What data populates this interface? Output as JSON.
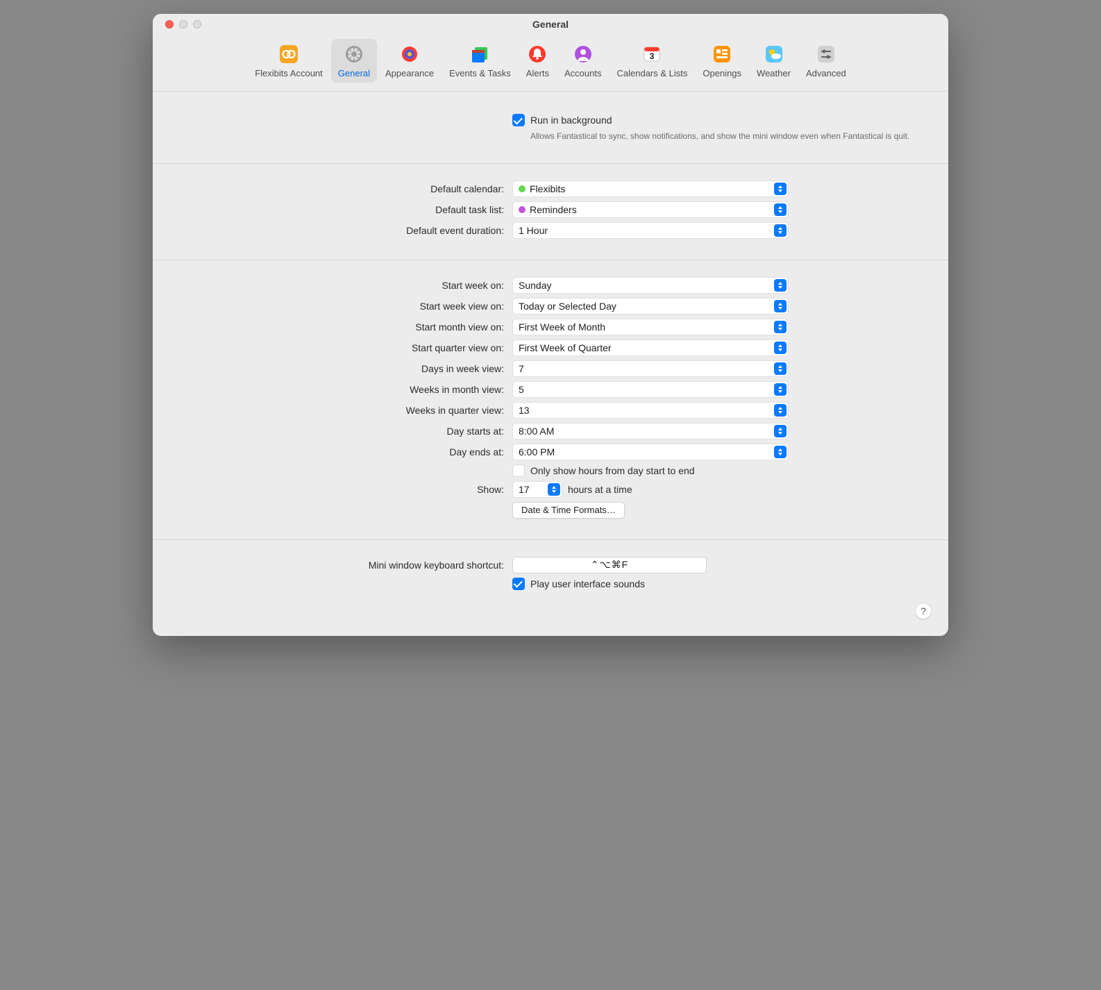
{
  "window": {
    "title": "General"
  },
  "tabs": [
    {
      "label": "Flexibits Account"
    },
    {
      "label": "General"
    },
    {
      "label": "Appearance"
    },
    {
      "label": "Events & Tasks"
    },
    {
      "label": "Alerts"
    },
    {
      "label": "Accounts"
    },
    {
      "label": "Calendars & Lists"
    },
    {
      "label": "Openings"
    },
    {
      "label": "Weather"
    },
    {
      "label": "Advanced"
    }
  ],
  "background": {
    "label": "Run in background",
    "sub": "Allows Fantastical to sync, show notifications, and show the mini window even when Fantastical is quit."
  },
  "defaults": {
    "calendar_label": "Default calendar:",
    "calendar_value": "Flexibits",
    "tasklist_label": "Default task list:",
    "tasklist_value": "Reminders",
    "duration_label": "Default event duration:",
    "duration_value": "1 Hour"
  },
  "views": {
    "start_week_label": "Start week on:",
    "start_week_value": "Sunday",
    "start_weekview_label": "Start week view on:",
    "start_weekview_value": "Today or Selected Day",
    "start_month_label": "Start month view on:",
    "start_month_value": "First Week of Month",
    "start_quarter_label": "Start quarter view on:",
    "start_quarter_value": "First Week of Quarter",
    "days_week_label": "Days in week view:",
    "days_week_value": "7",
    "weeks_month_label": "Weeks in month view:",
    "weeks_month_value": "5",
    "weeks_quarter_label": "Weeks in quarter view:",
    "weeks_quarter_value": "13",
    "day_start_label": "Day starts at:",
    "day_start_value": "8:00 AM",
    "day_end_label": "Day ends at:",
    "day_end_value": "6:00 PM",
    "only_show_label": "Only show hours from day start to end",
    "show_label": "Show:",
    "show_value": "17",
    "show_suffix": "hours at a time",
    "formats_button": "Date & Time Formats…"
  },
  "misc": {
    "shortcut_label": "Mini window keyboard shortcut:",
    "shortcut_value": "⌃⌥⌘F",
    "sounds_label": "Play user interface sounds"
  },
  "help": "?"
}
